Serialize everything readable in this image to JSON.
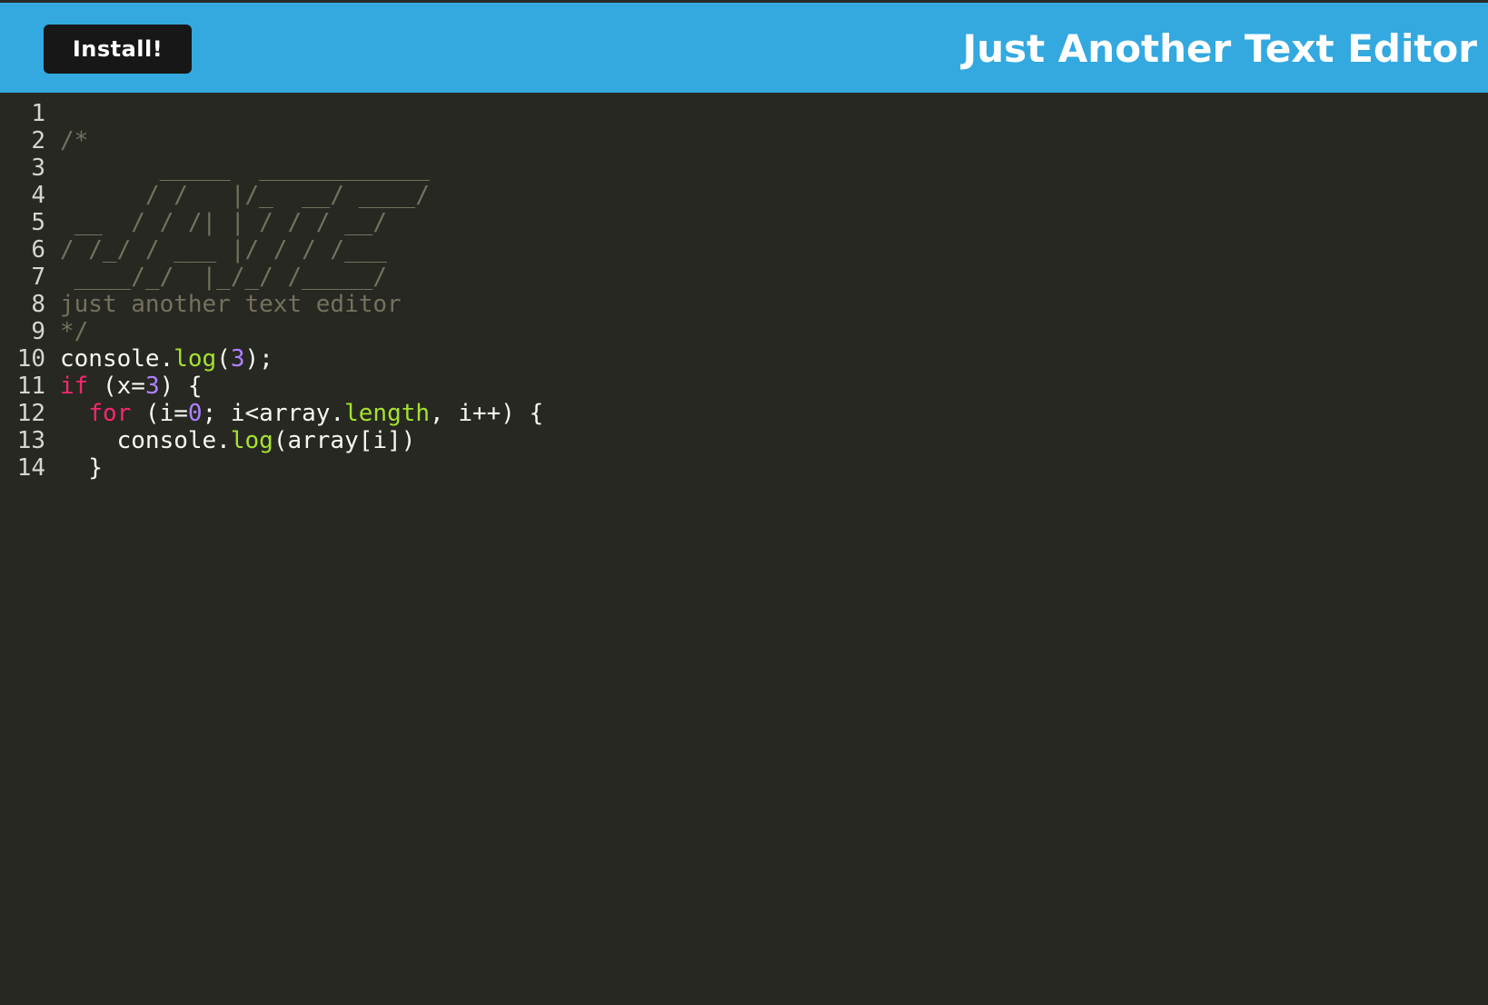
{
  "header": {
    "install_label": "Install!",
    "title": "Just Another Text Editor"
  },
  "colors": {
    "header_bg": "#33a9e0",
    "button_bg": "#171717",
    "editor_bg": "#272822",
    "comment": "#75715e",
    "keyword": "#f92672",
    "number": "#ae81ff",
    "property": "#a6e22e",
    "text": "#f8f8f2"
  },
  "editor": {
    "language": "javascript",
    "lines": [
      {
        "no": "1",
        "tokens": []
      },
      {
        "no": "2",
        "tokens": [
          {
            "t": "comment",
            "v": "/*"
          }
        ]
      },
      {
        "no": "3",
        "tokens": [
          {
            "t": "comment",
            "v": "       _____  ____________"
          }
        ]
      },
      {
        "no": "4",
        "tokens": [
          {
            "t": "comment",
            "v": "      / /   |/_  __/ ____/"
          }
        ]
      },
      {
        "no": "5",
        "tokens": [
          {
            "t": "comment",
            "v": " __  / / /| | / / / __/"
          }
        ]
      },
      {
        "no": "6",
        "tokens": [
          {
            "t": "comment",
            "v": "/ /_/ / ___ |/ / / /___"
          }
        ]
      },
      {
        "no": "7",
        "tokens": [
          {
            "t": "comment",
            "v": " ____/_/  |_/_/ /_____/"
          }
        ]
      },
      {
        "no": "8",
        "tokens": [
          {
            "t": "comment",
            "v": "just another text editor"
          }
        ]
      },
      {
        "no": "9",
        "tokens": [
          {
            "t": "comment",
            "v": "*/"
          }
        ]
      },
      {
        "no": "10",
        "tokens": [
          {
            "t": "plain",
            "v": "console."
          },
          {
            "t": "prop",
            "v": "log"
          },
          {
            "t": "plain",
            "v": "("
          },
          {
            "t": "number",
            "v": "3"
          },
          {
            "t": "plain",
            "v": ");"
          }
        ]
      },
      {
        "no": "11",
        "tokens": [
          {
            "t": "keyword",
            "v": "if"
          },
          {
            "t": "plain",
            "v": " (x="
          },
          {
            "t": "number",
            "v": "3"
          },
          {
            "t": "plain",
            "v": ") {"
          }
        ]
      },
      {
        "no": "12",
        "tokens": [
          {
            "t": "plain",
            "v": "  "
          },
          {
            "t": "keyword",
            "v": "for"
          },
          {
            "t": "plain",
            "v": " (i="
          },
          {
            "t": "number",
            "v": "0"
          },
          {
            "t": "plain",
            "v": "; i<array."
          },
          {
            "t": "prop",
            "v": "length"
          },
          {
            "t": "plain",
            "v": ", i++) {"
          }
        ]
      },
      {
        "no": "13",
        "tokens": [
          {
            "t": "plain",
            "v": "    console."
          },
          {
            "t": "prop",
            "v": "log"
          },
          {
            "t": "plain",
            "v": "(array[i])"
          }
        ]
      },
      {
        "no": "14",
        "tokens": [
          {
            "t": "plain",
            "v": "  }"
          }
        ]
      }
    ]
  }
}
